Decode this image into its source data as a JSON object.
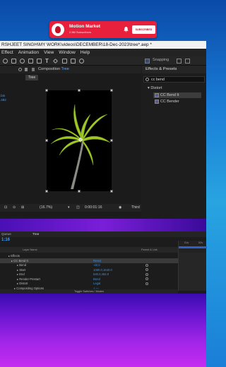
{
  "banner": {
    "title": "Motion Market",
    "subscribers": "2.5M Subscribers",
    "subscribe_label": "SUBSCRIBED"
  },
  "window": {
    "title": "RSHJEET SINGH\\MY WORK\\videos\\DECEMBER\\18-Dec-2023\\tree*.aep *"
  },
  "menu": {
    "items": [
      "Effect",
      "Animation",
      "View",
      "Window",
      "Help"
    ]
  },
  "toolbar": {
    "snapping_label": "Snapping"
  },
  "composition": {
    "tab_prefix": "Composition",
    "tab_name": "Tree",
    "tag": "Tree",
    "side_values": [
      ".bin",
      ".482"
    ]
  },
  "comp_footer": {
    "zoom": "(16.7%)",
    "timecode": "0:00:01:16",
    "view": "Third"
  },
  "effects_panel": {
    "title": "Effects & Presets",
    "search_value": "cc bend",
    "category": "Distort",
    "items": [
      "CC Bend It",
      "CC Bender"
    ]
  },
  "timeline": {
    "tabs": [
      "Queue",
      "Tree"
    ],
    "time": "1:16",
    "headers": {
      "layer_name": "Layer Name",
      "parent": "Parent & Link"
    },
    "ruler_labels": [
      "01s",
      "02s"
    ],
    "rows": [
      {
        "indent": 12,
        "name": "Effects",
        "value": "",
        "stopwatch": false
      },
      {
        "indent": 16,
        "name": "CC Bend It",
        "value": "Reset",
        "stopwatch": false,
        "selected": true
      },
      {
        "indent": 24,
        "name": "Bend",
        "value": "-40.0",
        "stopwatch": true
      },
      {
        "indent": 24,
        "name": "Start",
        "value": "1080.0,1640.0",
        "stopwatch": true
      },
      {
        "indent": 24,
        "name": "End",
        "value": "540.0,482.0",
        "stopwatch": true
      },
      {
        "indent": 24,
        "name": "Render Prestart",
        "value": "Bend",
        "stopwatch": true
      },
      {
        "indent": 24,
        "name": "Distort",
        "value": "Legal",
        "stopwatch": true
      },
      {
        "indent": 20,
        "name": "Compositing Options",
        "value": "+  —",
        "stopwatch": false
      }
    ],
    "footer": "Toggle Switches / Modes"
  }
}
